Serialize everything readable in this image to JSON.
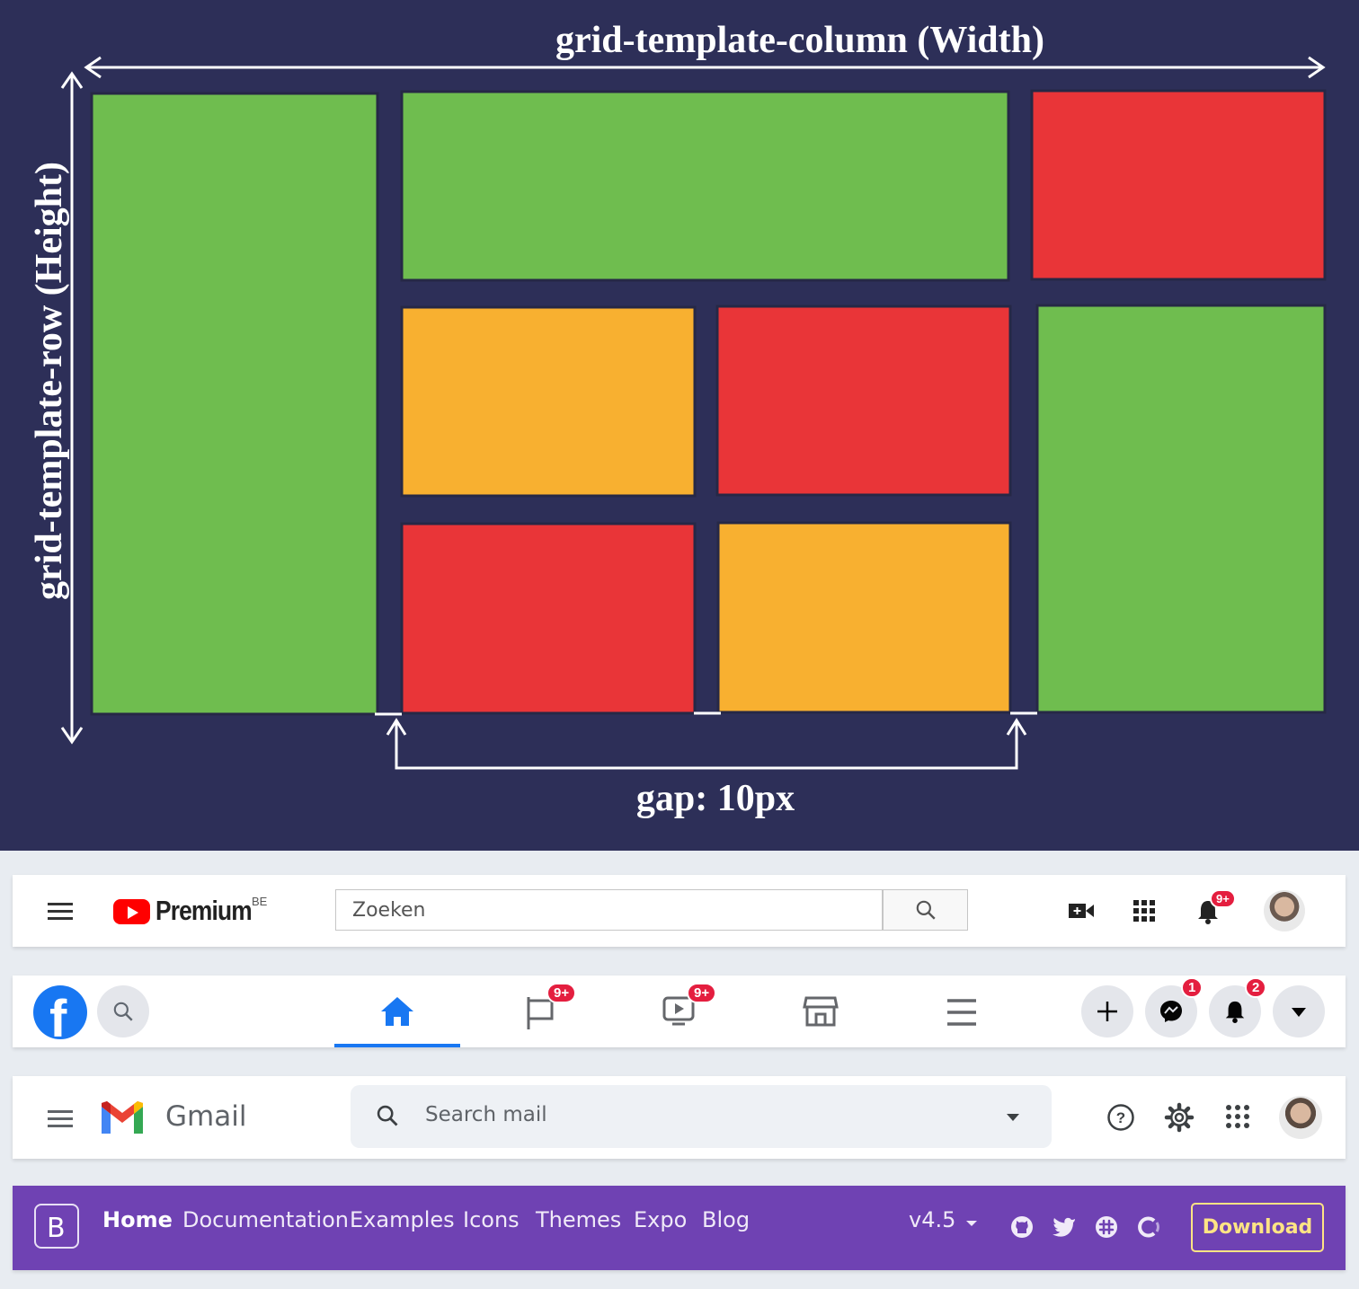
{
  "diagram": {
    "title_top": "grid-template-column (Width)",
    "title_left": "grid-template-row (Height)",
    "gap_label": "gap: 10px",
    "colors": {
      "background": "#2d2f58",
      "green": "#6fbd4f",
      "red": "#e93538",
      "orange": "#f8b030"
    }
  },
  "youtube": {
    "brand": "Premium",
    "region": "BE",
    "search_placeholder": "Zoeken",
    "notification_count": "9+",
    "icons": [
      "menu-icon",
      "youtube-logo-icon",
      "search-icon",
      "video-camera-icon",
      "apps-grid-icon",
      "bell-icon",
      "avatar"
    ]
  },
  "facebook": {
    "pages_badge": "9+",
    "watch_badge": "9+",
    "messenger_badge": "1",
    "notifications_badge": "2",
    "icons": [
      "facebook-logo-icon",
      "search-icon",
      "home-icon",
      "flag-icon",
      "video-icon",
      "store-icon",
      "menu-icon",
      "plus-icon",
      "messenger-icon",
      "bell-icon",
      "caret-down-icon"
    ]
  },
  "gmail": {
    "brand": "Gmail",
    "search_placeholder": "Search mail",
    "icons": [
      "menu-icon",
      "gmail-logo-icon",
      "search-icon",
      "caret-down-icon",
      "help-icon",
      "gear-icon",
      "apps-grid-icon",
      "avatar"
    ]
  },
  "bootstrap": {
    "logo": "B",
    "nav": [
      "Home",
      "Documentation",
      "Examples",
      "Icons",
      "Themes",
      "Expo",
      "Blog"
    ],
    "version": "v4.5",
    "download": "Download",
    "icons": [
      "github-icon",
      "twitter-icon",
      "slack-icon",
      "opencollective-icon"
    ]
  }
}
